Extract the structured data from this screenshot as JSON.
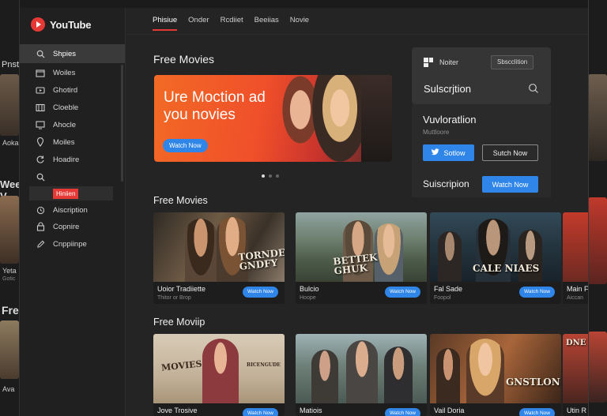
{
  "app": {
    "logo_text": "YouTube"
  },
  "top_tabs": [
    {
      "label": "Phisiue",
      "active": true
    },
    {
      "label": "Onder",
      "active": false
    },
    {
      "label": "Rcdiiet",
      "active": false
    },
    {
      "label": "Beeiias",
      "active": false
    },
    {
      "label": "Novie",
      "active": false
    }
  ],
  "sidebar": {
    "items": [
      {
        "label": "Shpies",
        "icon": "search-icon",
        "active": true
      },
      {
        "label": "Woiles",
        "icon": "folder-icon",
        "active": false
      },
      {
        "label": "Ghotird",
        "icon": "video-icon",
        "active": false
      },
      {
        "label": "Cloeble",
        "icon": "film-icon",
        "active": false
      },
      {
        "label": "Ahocle",
        "icon": "monitor-icon",
        "active": false
      },
      {
        "label": "Moiles",
        "icon": "location-icon",
        "active": false
      },
      {
        "label": "Hoadire",
        "icon": "refresh-icon",
        "active": false
      },
      {
        "label": "",
        "icon": "search-icon",
        "active": false
      },
      {
        "label": "Aiscription",
        "icon": "clock-icon",
        "active": false
      },
      {
        "label": "Copnire",
        "icon": "lock-icon",
        "active": false
      },
      {
        "label": "Cnppiinpe",
        "icon": "pencil-icon",
        "active": false
      }
    ],
    "badge": "Hiniien"
  },
  "hero": {
    "section_title": "Free Movies",
    "headline": "Ure Moction ad you novies",
    "button": "Watch Now"
  },
  "panel": {
    "notifier_label": "Noiter",
    "subscribe_pill": "Sbscclition",
    "title": "Sulscrjtion",
    "promo_title": "Vuvloratlion",
    "promo_sub": "Muttloore",
    "follow_button": "Sotlow",
    "watch_outline_button": "Sutch Now",
    "bottom_label": "Suiscripion",
    "bottom_button": "Watch Now"
  },
  "row1": {
    "title": "Free Movies",
    "cards": [
      {
        "title": "Uoior Tradiiette",
        "sub": "Thitor or Brop",
        "button": "Watch Now",
        "poster": "TORNDEED GNDFY",
        "tone": "#4a4236"
      },
      {
        "title": "Bulcio",
        "sub": "Hoope",
        "button": "Watch Now",
        "poster": "BETTEK GHUK",
        "tone": "#5d6b5a"
      },
      {
        "title": "Fal Sade",
        "sub": "Foopol",
        "button": "Watch Now",
        "poster": "CALE NIAES",
        "tone": "#2c3a44"
      }
    ]
  },
  "row2": {
    "title": "Free Moviip",
    "cards": [
      {
        "title": "Jove Trosive",
        "sub": "",
        "button": "Watch Now",
        "poster": "MOVIES",
        "poster2": "BICENGUDE",
        "tone": "#c9b9a3"
      },
      {
        "title": "Matiois",
        "sub": "",
        "button": "Watch Now",
        "poster": "",
        "tone": "#6c7a72"
      },
      {
        "title": "Vail Doria",
        "sub": "",
        "button": "Watch Now",
        "poster": "GNSTLON",
        "tone": "#7a4a2c"
      }
    ]
  },
  "background": {
    "left_texts": [
      "Pnst",
      "Aoka",
      "Wee V",
      "Yeta",
      "Gotic",
      "Free",
      "Ava"
    ],
    "right_texts": [
      "Main F",
      "Aiccan",
      "Utin R",
      "DNE"
    ]
  }
}
